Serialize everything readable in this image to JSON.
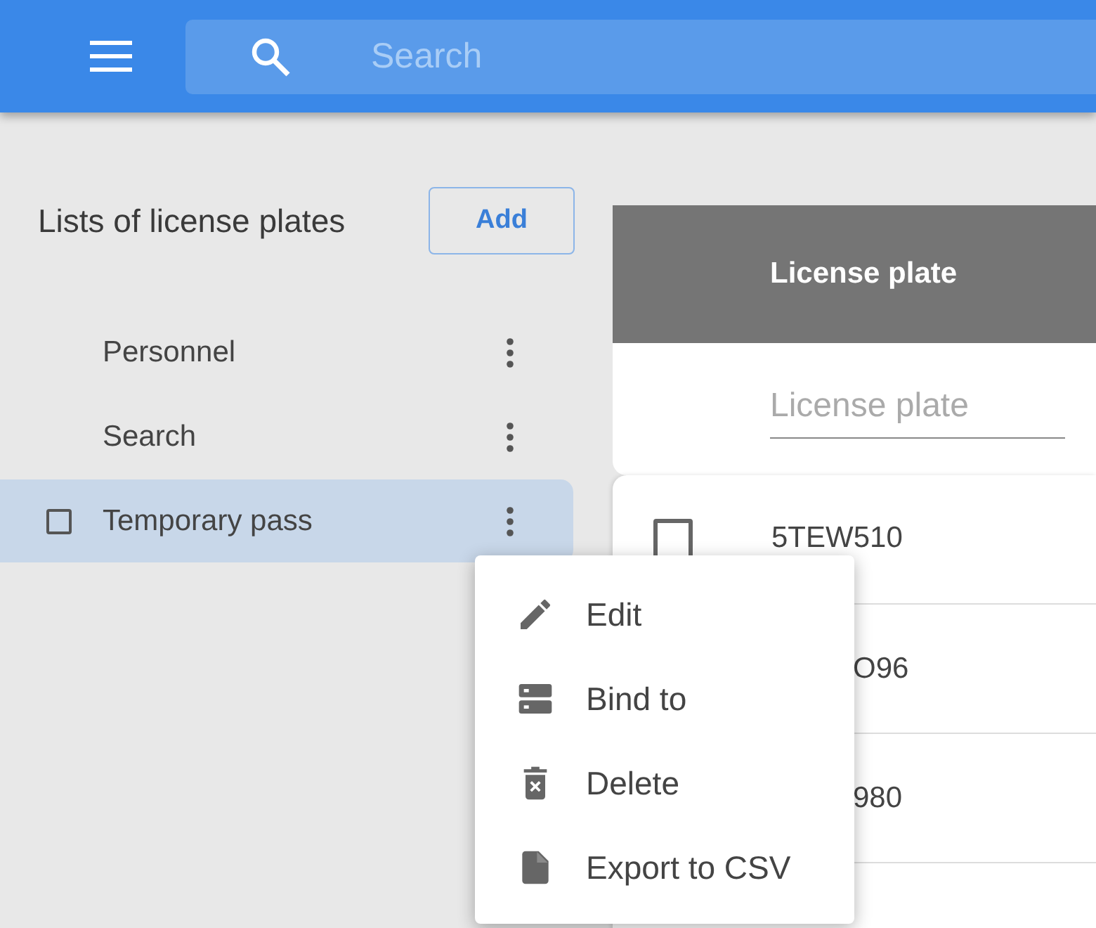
{
  "header": {
    "search": {
      "placeholder": "Search"
    }
  },
  "sidebar": {
    "title": "Lists of license plates",
    "add_button": "Add",
    "items": [
      {
        "label": "Personnel",
        "selected": false
      },
      {
        "label": "Search",
        "selected": false
      },
      {
        "label": "Temporary pass",
        "selected": true
      }
    ]
  },
  "table": {
    "columns": [
      "License plate"
    ],
    "filter": {
      "placeholder": "License plate"
    },
    "rows": [
      {
        "plate": "5TEW510",
        "kind": "full",
        "checked": false
      },
      {
        "plate": "O96",
        "kind": "covered"
      },
      {
        "plate": "980",
        "kind": "covered"
      }
    ]
  },
  "context_menu": {
    "items": [
      {
        "label": "Edit"
      },
      {
        "label": "Bind to"
      },
      {
        "label": "Delete"
      },
      {
        "label": "Export to CSV"
      }
    ]
  }
}
